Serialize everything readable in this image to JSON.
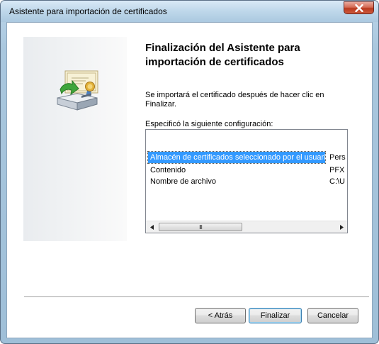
{
  "window": {
    "title": "Asistente para importación de certificados"
  },
  "icons": {
    "close": "close-icon",
    "wizard": "certificate-import-icon"
  },
  "main": {
    "heading_line1": "Finalización del Asistente para",
    "heading_line2": "importación de certificados",
    "description": "Se importará el certificado después de hacer clic en Finalizar.",
    "config_label": "Especificó la siguiente configuración:",
    "settings": [
      {
        "name": "Almacén de certificados seleccionado por el usuario",
        "value": "Pers"
      },
      {
        "name": "Contenido",
        "value": "PFX"
      },
      {
        "name": "Nombre de archivo",
        "value": "C:\\U"
      }
    ],
    "scroll_thumb_grip": "III"
  },
  "buttons": {
    "back": "< Atrás",
    "finish": "Finalizar",
    "cancel": "Cancelar"
  },
  "colors": {
    "selection": "#3399ff",
    "frame": "#abc9e0",
    "close": "#c9472b"
  }
}
